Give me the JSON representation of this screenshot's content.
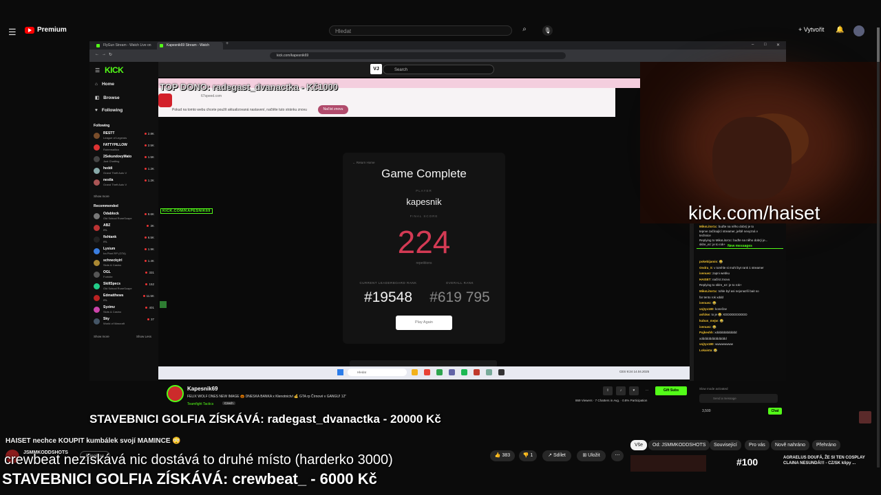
{
  "youtube": {
    "logo_text": "Premium",
    "search_placeholder": "Hledat",
    "create_label": "Vytvořit",
    "video_title": "HAISET nechce KOUPIT kumbálek svojí MAMINCE 😳",
    "channel": "JSMMKODDSHOTS",
    "join_label": "Připojit se",
    "likes": "383",
    "dislikes": "1",
    "share_label": "Sdílet",
    "save_label": "Uložit",
    "chips": [
      "Vše",
      "Od: JSMMKODDSHOTS",
      "Související",
      "Pro vás",
      "Nově nahráno",
      "Přehráno"
    ],
    "rec_badge": "#100",
    "rec_title": "AGRAELUS DOUFÁ, ŽE SI TEN COSPLAY CLAINA NESUNDÁ!!! - CZ/SK klipy ..."
  },
  "browser": {
    "tabs": [
      "FlyGun Stream - Watch Live on Kick",
      "Kapesnik69 Stream - Watch"
    ],
    "url": "kick.com/kapesnik69"
  },
  "kick": {
    "logo": "KICK",
    "search_placeholder": "Search",
    "vj_label": "VJ",
    "nav": [
      "Home",
      "Browse",
      "Following"
    ],
    "following_title": "Following",
    "following": [
      {
        "name": "RESTT",
        "game": "League of Legends",
        "viewers": "2.8K",
        "color": "#7a4d2a"
      },
      {
        "name": "FATTYPILLOW",
        "game": "Rubensailica",
        "viewers": "2.5K",
        "color": "#d33"
      },
      {
        "name": "2SekundovyMato",
        "game": "Just Chatting",
        "viewers": "1.5K",
        "color": "#444"
      },
      {
        "name": "heddi",
        "game": "Grand Theft Auto V",
        "viewers": "1.2K",
        "color": "#8aa"
      },
      {
        "name": "nestla",
        "game": "Grand Theft Auto V",
        "viewers": "1.2K",
        "color": "#a55"
      }
    ],
    "show_more": "Show more",
    "show_less": "Show Less",
    "recommended_title": "Recommended",
    "recommended": [
      {
        "name": "Odablock",
        "game": "Old School RuneScape",
        "viewers": "9.6K",
        "color": "#777"
      },
      {
        "name": "ABZ",
        "game": "IRL",
        "viewers": "3K",
        "color": "#b33"
      },
      {
        "name": "fishtank",
        "game": "IRL",
        "viewers": "6.5K",
        "color": "#222"
      },
      {
        "name": "Lysium",
        "game": "Ira Pixel RP (GTA)",
        "viewers": "1.9K",
        "color": "#3a7de0"
      },
      {
        "name": "schneckyirl",
        "game": "Slots & Casino",
        "viewers": "1.4K",
        "color": "#a83"
      },
      {
        "name": "OGL",
        "game": "Fortnite",
        "viewers": "331",
        "color": "#555"
      },
      {
        "name": "SkillSpecs",
        "game": "Old School RuneScape",
        "viewers": "152",
        "color": "#2c8"
      },
      {
        "name": "Edmatthews",
        "game": "IRL",
        "viewers": "11.5K",
        "color": "#b22"
      },
      {
        "name": "Syzimz",
        "game": "Slots & Casino",
        "viewers": "401",
        "color": "#c4a"
      },
      {
        "name": "Sky",
        "game": "World of Warcraft",
        "viewers": "37",
        "color": "#456"
      }
    ]
  },
  "overlay": {
    "top_dono": "TOP DONO: radegast_dvanactka - Kč1000",
    "kick_tag": "KICK.COM/KAPESNIK69",
    "webcam_url": "kick.com/haiset",
    "line1": "STAVEBNICI GOLFIA ZÍSKÁVÁ: radegast_dvanactka - 20000 Kč",
    "line2": "crewbeat nezískává nic dostává to druhé místo (harderko 3000)",
    "line3": "STAVEBNICI GOLFIA ZÍSKÁVÁ: crewbeat_ - 6000 Kč"
  },
  "site": {
    "url": "67speed.com",
    "message": "Pokud na tomto webu chcete použít aktualizovaná nastavení, načtěte tuto stránku znovu",
    "reload_label": "Načíst znovu"
  },
  "game": {
    "back": "← Return Home",
    "title": "Game Complete",
    "player_label": "PLAYER",
    "player": "kapesnik",
    "final_label": "FINAL SCORE",
    "score": "224",
    "reps": "repetitions",
    "current_rank_label": "CURRENT LEADERBOARD RANK",
    "overall_rank_label": "OVERALL RANK",
    "current_rank": "#19548",
    "overall_rank": "#619 795",
    "play_again": "Play Again"
  },
  "taskbar": {
    "search": "Hledat",
    "time": "9:24",
    "date": "14.04.2025"
  },
  "stream": {
    "name": "Kapesnik69",
    "title": "FELIX WOLF DNES NEW IMAGE 🎃 DNESKA BANKA x Klenotnictví 💰 GTA rp Čírnové v GANGU! 12\"",
    "category": "Teamfight Tactics",
    "language": "Czech",
    "stats": "869 Viewers  ·  7 Chatters in Avg.  ·  0.8% Participation",
    "gift_label": "Gift Subs"
  },
  "chat": {
    "new_messages": "New messages",
    "lines": [
      {
        "user": "MikoLitor1c",
        "text": "buďte na něho dobrý je to"
      },
      {
        "user": "",
        "text": "teprve začínající streamer, ještě nevyzná v"
      },
      {
        "user": "",
        "text": "technice"
      },
      {
        "user": "",
        "text": "Replying to MikoLitor1c: buďte na něho dobrý je..."
      },
      {
        "user": "",
        "text": "sklre_ez: je to rok+"
      },
      {
        "user": "pokebijamis",
        "text": "😂"
      },
      {
        "user": "Ondra_S",
        "text": "v tomhle si mohl byt rank 1 streamer"
      },
      {
        "user": "ivenuez",
        "text": "zapni webku"
      },
      {
        "user": "HAISET",
        "text": "načíst znovu"
      },
      {
        "user": "",
        "text": "Replying to sklre_ez: je to rok+"
      },
      {
        "user": "MikoLitor1c",
        "text": "tohle byl asi nejonazší bait so"
      },
      {
        "user": "",
        "text": "far tento rok xddd"
      },
      {
        "user": "ivenuez",
        "text": "😂"
      },
      {
        "user": "vojtyx180",
        "text": "konečne"
      },
      {
        "user": "asfckw",
        "text": "to je  😂 XDDDDDDDDDD"
      },
      {
        "user": "kubus_mejw",
        "text": "😂"
      },
      {
        "user": "ivenuez",
        "text": "😂"
      },
      {
        "user": "Pajkeshh",
        "text": "xdddddddddddd"
      },
      {
        "user": "",
        "text": "xddddddddddddddd"
      },
      {
        "user": "vojtyx180",
        "text": "wwwwwwww"
      },
      {
        "user": "Lokaista",
        "text": "😂"
      }
    ],
    "slow_mode": "Slow mode activated",
    "input_placeholder": "Send a message",
    "points": "3,500",
    "chat_label": "Chat"
  }
}
